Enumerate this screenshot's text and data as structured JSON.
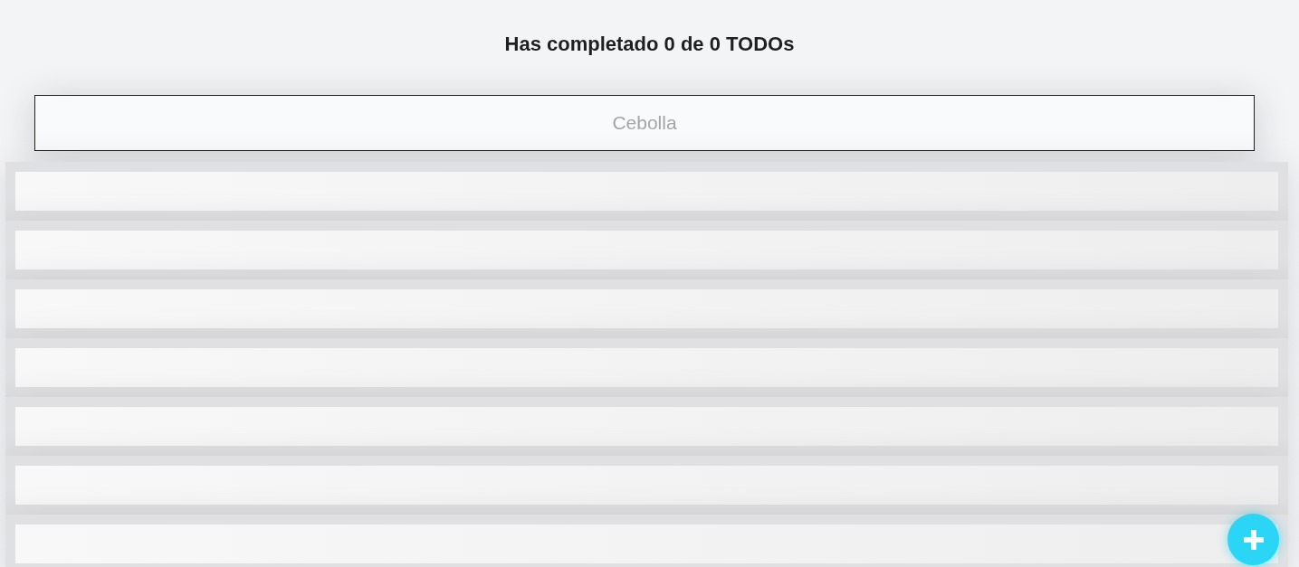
{
  "header": {
    "title": "Has completado 0 de 0 TODOs"
  },
  "search": {
    "placeholder": "Cebolla"
  },
  "todo_list": {
    "loading": true
  }
}
